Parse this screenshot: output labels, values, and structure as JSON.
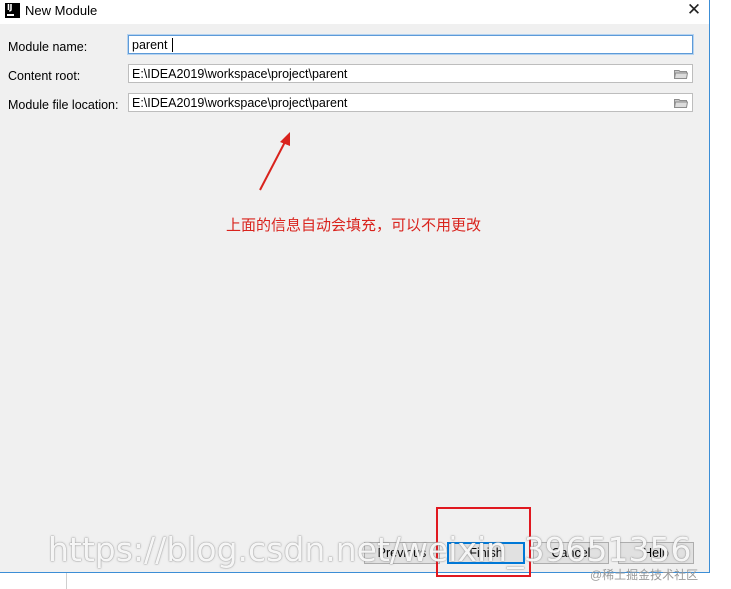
{
  "window": {
    "logo_text": "IJ",
    "title": "New Module",
    "close_glyph": "✕"
  },
  "form": {
    "module_name": {
      "label": "Module name:",
      "value": "parent"
    },
    "content_root": {
      "label": "Content root:",
      "value": "E:\\IDEA2019\\workspace\\project\\parent"
    },
    "module_file_location": {
      "label": "Module file location:",
      "value": "E:\\IDEA2019\\workspace\\project\\parent"
    }
  },
  "annotation": {
    "text": "上面的信息自动会填充，可以不用更改",
    "color": "#d9231d"
  },
  "buttons": {
    "previous": "Previous",
    "finish": "Finish",
    "cancel": "Cancel",
    "help": "Help"
  },
  "watermarks": {
    "main": "https://blog.csdn.net/weixin_39651356",
    "corner": "@稀土掘金技术社区"
  },
  "icons": {
    "browse": "folder-icon",
    "logo": "intellij-logo-icon",
    "close": "close-icon"
  },
  "colors": {
    "accent": "#0078d7",
    "highlight_box": "#e0181f"
  }
}
